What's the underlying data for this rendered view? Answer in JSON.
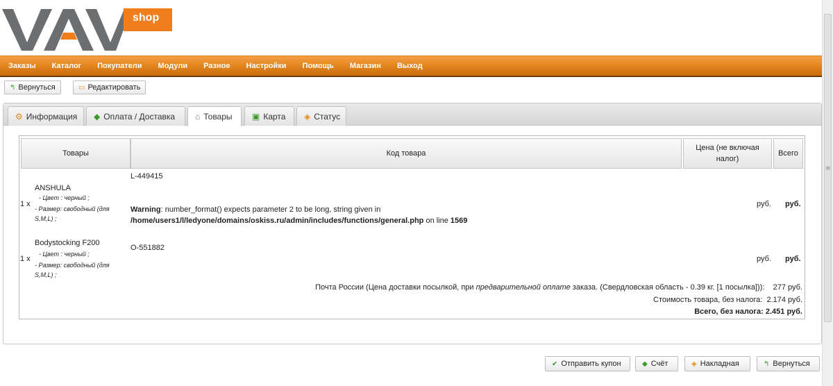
{
  "logo": {
    "brand": "VAM",
    "badge": "shop"
  },
  "menu": [
    "Заказы",
    "Каталог",
    "Покупатели",
    "Модули",
    "Разное",
    "Настройки",
    "Помощь",
    "Магазин",
    "Выход"
  ],
  "top_buttons": {
    "back": "Вернуться",
    "edit": "Редактировать"
  },
  "tabs": [
    {
      "label": "Информация",
      "icon": "info-icon"
    },
    {
      "label": "Оплата / Доставка",
      "icon": "payment-icon"
    },
    {
      "label": "Товары",
      "icon": "products-icon",
      "active": true
    },
    {
      "label": "Карта",
      "icon": "map-icon"
    },
    {
      "label": "Статус",
      "icon": "status-icon"
    }
  ],
  "table": {
    "headers": {
      "products": "Товары",
      "code": "Код товара",
      "price": "Цена (не включая налог)",
      "total": "Всего"
    },
    "rows": [
      {
        "qty": "1 x",
        "name": "ANSHULA",
        "attrs": [
          "- Цвет : черный ;",
          "- Размер: свободный (для S,M,L) ;"
        ],
        "code": "L-449415",
        "price": "руб.",
        "total": "руб."
      },
      {
        "qty": "1 x",
        "name": "Bodystocking F200",
        "attrs": [
          "- Цвет : черный ;",
          "- Размер: свободный (для S,M,L) ;"
        ],
        "code": "O-551882",
        "price": "руб.",
        "total": "руб."
      }
    ],
    "warning": {
      "label": "Warning",
      "message": ": number_format() expects parameter 2 to be long, string given in",
      "path": "/home/users1/l/ledyone/domains/oskiss.ru/admin/includes/functions/general.php",
      "on_line": " on line ",
      "line": "1569"
    }
  },
  "totals": {
    "shipping_pre": "Почта России (Цена доставки посылкой, при ",
    "shipping_em": "предварительной оплате",
    "shipping_post": " заказа. (Свердловская область - 0.39 кг. [1 посылка])):",
    "shipping_value": "277 руб.",
    "subtotal_label": "Стоимость товара, без налога:",
    "subtotal_value": "2.174 руб.",
    "total_label": "Всего, без налога:",
    "total_value": "2.451 руб."
  },
  "bottom_buttons": {
    "coupon": "Отправить купон",
    "invoice": "Счёт",
    "packing": "Накладная",
    "back": "Вернуться"
  },
  "colors": {
    "menu_orange": "#e98a22",
    "logo_gray": "#6d6e70",
    "logo_orange": "#f07e1c"
  }
}
